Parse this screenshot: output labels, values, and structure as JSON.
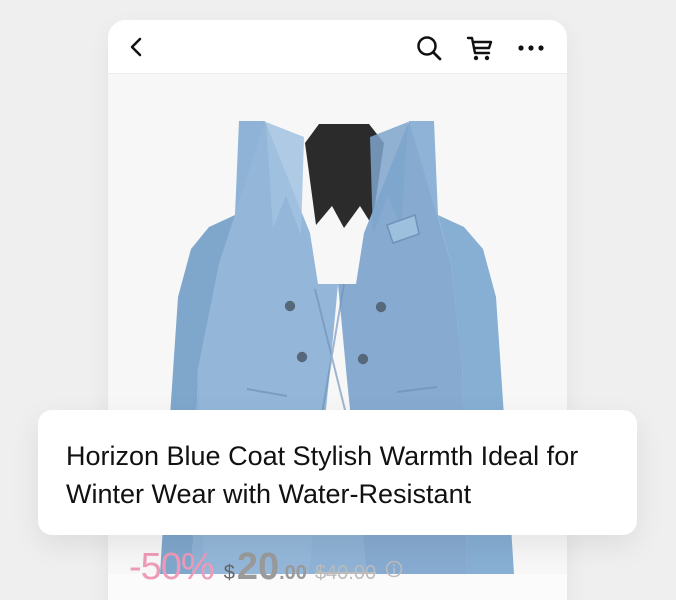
{
  "product": {
    "title": "Horizon Blue Coat Stylish Warmth Ideal for Winter Wear with Water-Resistant",
    "discount": "-50%",
    "currency": "$",
    "price_main": "20",
    "price_cents": ".00",
    "original_price": "$40.00",
    "image_alt": "Light blue double-breasted coat"
  },
  "icons": {
    "back": "chevron-left-icon",
    "search": "search-icon",
    "cart": "shopping-cart-icon",
    "more": "more-horizontal-icon",
    "info": "info-icon"
  },
  "colors": {
    "background": "#efefef",
    "coat": "#8fb3d6",
    "discount": "#ee9ab8",
    "text": "#111111"
  }
}
